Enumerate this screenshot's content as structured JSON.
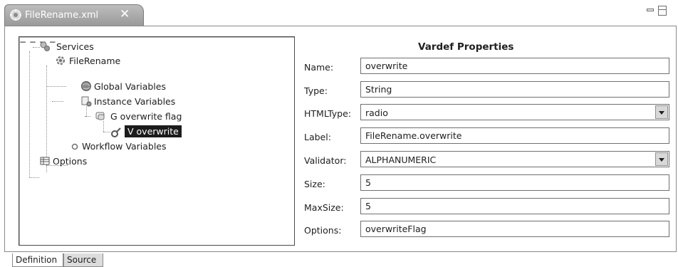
{
  "editor": {
    "tab_title": "FileRename.xml",
    "close_symbol": "✕",
    "icons": [
      "xml-file-icon",
      "close-icon",
      "minimize-icon",
      "maximize-icon"
    ]
  },
  "tree": {
    "nodes": [
      {
        "label": "Services",
        "icon": "services-icon",
        "expanded": true
      },
      {
        "label": "FileRename",
        "icon": "gear-icon",
        "expanded": true
      },
      {
        "label": "Global Variables",
        "icon": "globe-icon"
      },
      {
        "label": "Instance Variables",
        "icon": "variables-icon",
        "expanded": true
      },
      {
        "label": "G overwrite flag",
        "icon": "group-icon",
        "expanded": true
      },
      {
        "label": "V overwrite",
        "icon": "variable-icon",
        "selected": true
      },
      {
        "label": "Workflow Variables",
        "icon": "workflow-icon"
      },
      {
        "label": "Options",
        "icon": "options-icon"
      }
    ]
  },
  "properties": {
    "title": "Vardef Properties",
    "fields": [
      {
        "label": "Name:",
        "value": "overwrite",
        "type": "text"
      },
      {
        "label": "Type:",
        "value": "String",
        "type": "text"
      },
      {
        "label": "HTMLType:",
        "value": "radio",
        "type": "select"
      },
      {
        "label": "Label:",
        "value": "FileRename.overwrite",
        "type": "text"
      },
      {
        "label": "Validator:",
        "value": "ALPHANUMERIC",
        "type": "select"
      },
      {
        "label": "Size:",
        "value": "5",
        "type": "text"
      },
      {
        "label": "MaxSize:",
        "value": "5",
        "type": "text"
      },
      {
        "label": "Options:",
        "value": "overwriteFlag",
        "type": "text"
      }
    ]
  },
  "bottom_tabs": [
    {
      "label": "Definition",
      "active": true
    },
    {
      "label": "Source",
      "active": false
    }
  ]
}
